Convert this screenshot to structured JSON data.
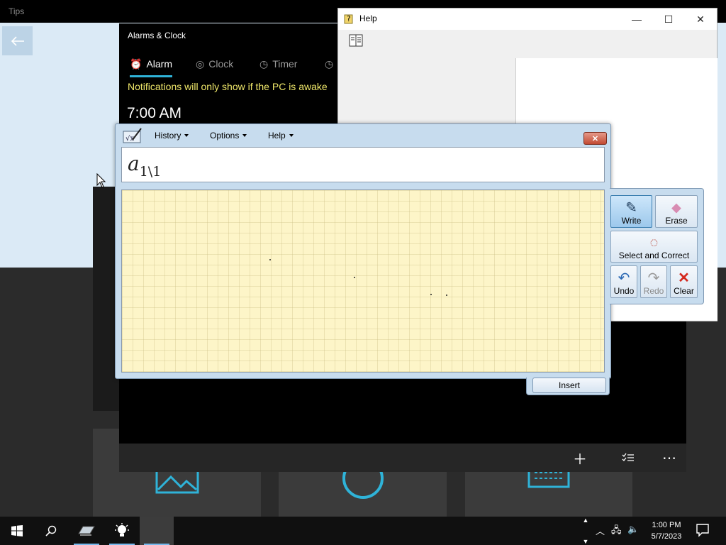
{
  "tips": {
    "title": "Tips"
  },
  "alarms": {
    "title": "Alarms & Clock",
    "tabs": [
      {
        "label": "Alarm",
        "icon": "alarm-clock-icon"
      },
      {
        "label": "Clock",
        "icon": "globe-icon"
      },
      {
        "label": "Timer",
        "icon": "timer-icon"
      },
      {
        "label": "",
        "icon": "stopwatch-icon"
      }
    ],
    "notice": "Notifications will only show if the PC is awake",
    "alarm_time": "7:00 AM"
  },
  "help": {
    "title": "Help"
  },
  "math_input": {
    "menus": [
      "History",
      "Options",
      "Help"
    ],
    "preview_main": "a",
    "preview_sub": "1\\1",
    "insert_label": "Insert",
    "tools": {
      "write": "Write",
      "erase": "Erase",
      "select_correct": "Select and Correct",
      "undo": "Undo",
      "redo": "Redo",
      "clear": "Clear"
    }
  },
  "taskbar": {
    "time": "1:00 PM",
    "date": "5/7/2023"
  }
}
